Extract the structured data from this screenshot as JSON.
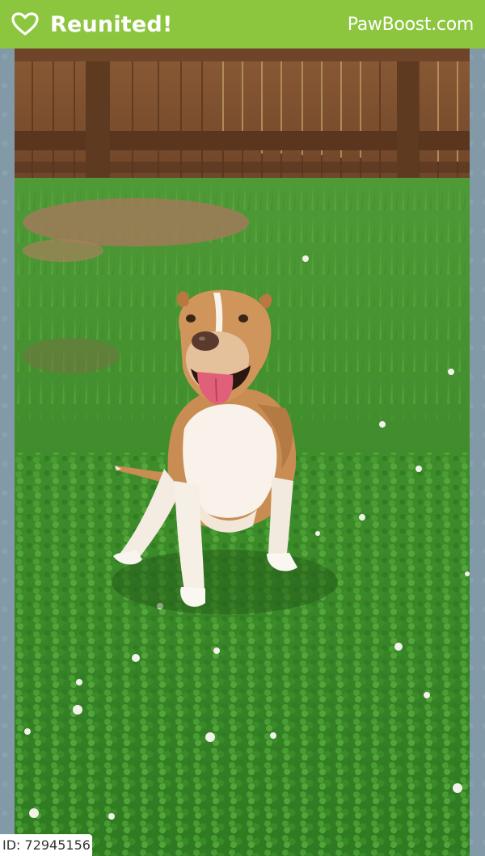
{
  "header": {
    "status_label": "Reunited!",
    "brand": "PawBoost.com",
    "bg_color": "#8cc63f",
    "icon": "heart-outline-icon"
  },
  "photo": {
    "subject": "dog-photo"
  },
  "listing": {
    "id_label": "ID: 72945156"
  }
}
